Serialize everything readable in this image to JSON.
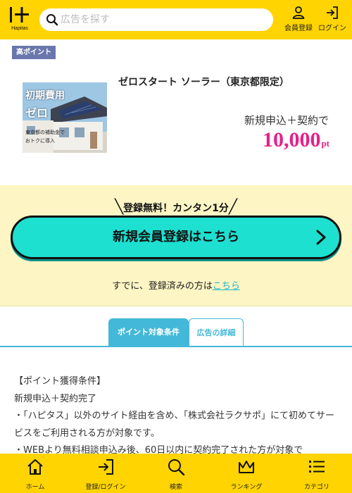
{
  "header": {
    "logo_text": "Hapitas",
    "search_placeholder": "広告を探す",
    "register_label": "会員登録",
    "login_label": "ログイン"
  },
  "ad": {
    "badge": "高ポイント",
    "title": "ゼロスタート ソーラー（東京都限定）",
    "condition": "新規申込＋契約で",
    "points_value": "10,000",
    "points_unit": "pt",
    "image_text": {
      "line1": "初期費用",
      "line2": "ゼロ",
      "line3": "東京都の補助金で",
      "line4": "おトクに導入"
    }
  },
  "register": {
    "free_text": "登録無料！カンタン1分",
    "button_label": "新規会員登録はこちら",
    "already_text": "すでに、登録済みの方は",
    "already_link": "こちら"
  },
  "tabs": [
    {
      "label": "ポイント対象条件",
      "active": true
    },
    {
      "label": "広告の詳細",
      "active": false
    }
  ],
  "conditions": {
    "heading": "【ポイント獲得条件】",
    "line1": "新規申込＋契約完了",
    "line2": "・「ハピタス」以外のサイト経由を含め、「株式会社ラクサポ」にて初めてサービスをご利用される方が対象です。",
    "line3": "・WEBより無料相談申込み後、60日以内に契約完了された方が対象で"
  },
  "bottom_nav": [
    {
      "label": "ホーム",
      "icon": "home-icon"
    },
    {
      "label": "登録/ログイン",
      "icon": "login-icon"
    },
    {
      "label": "検索",
      "icon": "search-icon"
    },
    {
      "label": "ランキング",
      "icon": "crown-icon"
    },
    {
      "label": "カテゴリ",
      "icon": "list-icon"
    }
  ],
  "colors": {
    "brand_yellow": "#ffd400",
    "points_pink": "#e5218a",
    "accent_cyan": "#1de0d0",
    "tab_blue": "#44b8d8",
    "badge_purple": "#6a77ad"
  }
}
